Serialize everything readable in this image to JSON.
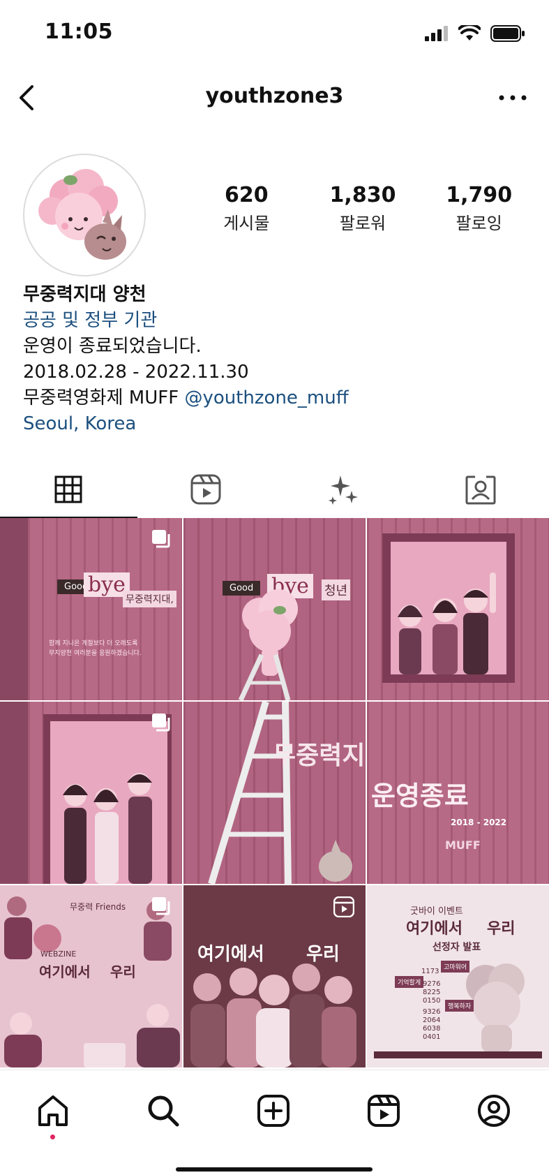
{
  "status_bar": {
    "time": "11:05"
  },
  "header": {
    "username": "youthzone3"
  },
  "profile": {
    "stats": [
      {
        "value": "620",
        "label": "게시물"
      },
      {
        "value": "1,830",
        "label": "팔로워"
      },
      {
        "value": "1,790",
        "label": "팔로잉"
      }
    ],
    "display_name": "무중력지대 양천",
    "category": "공공 및 정부 기관",
    "bio_line1": "운영이 종료되었습니다.",
    "bio_line2": "2018.02.28 - 2022.11.30",
    "bio_line3_text": "무중력영화제 MUFF ",
    "bio_line3_mention": "@youthzone_muff",
    "location": "Seoul, Korea"
  },
  "tabs": [
    {
      "name": "posts-grid",
      "icon": "grid-icon",
      "active": true
    },
    {
      "name": "reels",
      "icon": "reels-icon",
      "active": false
    },
    {
      "name": "guides",
      "icon": "sparkles-icon",
      "active": false
    },
    {
      "name": "tagged",
      "icon": "tagged-icon",
      "active": false
    }
  ],
  "posts": [
    {
      "type": "carousel",
      "texts": [
        "Good",
        "bye",
        "무중력지대,",
        "함께 지나온 계절보다 더 오래도록",
        "무지양천 여러분을 응원하겠습니다."
      ]
    },
    {
      "type": "carousel",
      "texts": [
        "Good",
        "bye",
        "청년"
      ]
    },
    {
      "type": "carousel",
      "texts": []
    },
    {
      "type": "carousel",
      "texts": []
    },
    {
      "type": "image",
      "texts": [
        "무중력지대 양천"
      ]
    },
    {
      "type": "image",
      "texts": [
        "운영종료",
        "2018 - 2022",
        "MUFF"
      ]
    },
    {
      "type": "carousel",
      "texts": [
        "무중력 Friends",
        "WEBZINE",
        "여기에서",
        "우리"
      ]
    },
    {
      "type": "reel",
      "texts": [
        "여기에서",
        "우리"
      ]
    },
    {
      "type": "image",
      "texts": [
        "굿바이 이벤트",
        "여기에서",
        "우리",
        "선정자 발표",
        "고마워어",
        "기억할게",
        "행복하자",
        "1173",
        "9276",
        "8225",
        "0150",
        "9326",
        "2064",
        "6038",
        "0401"
      ]
    }
  ],
  "bottom_nav": [
    "home-icon",
    "search-icon",
    "create-icon",
    "reels-icon",
    "profile-icon"
  ],
  "colors": {
    "link": "#1b4f7e",
    "tile_base": "#b05f7c",
    "dot": "#e0245e"
  }
}
